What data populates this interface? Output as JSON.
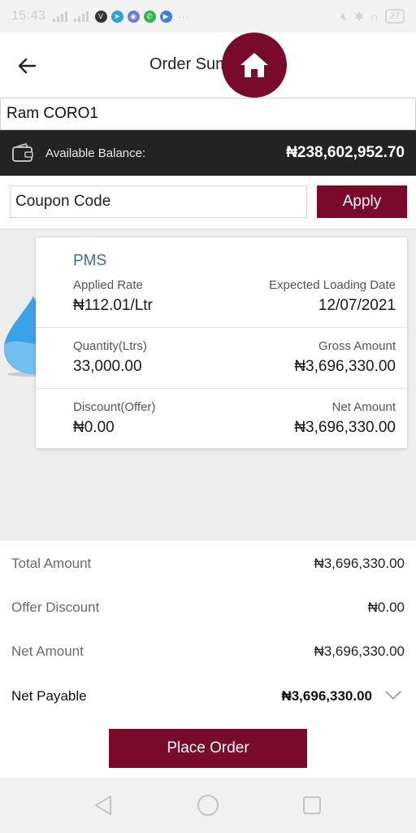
{
  "status_bar": {
    "time": "15:43",
    "battery": "27"
  },
  "header": {
    "title": "Order Summary"
  },
  "customer": {
    "name": "Ram CORO1"
  },
  "balance": {
    "label": "Available Balance:",
    "value": "₦238,602,952.70"
  },
  "coupon": {
    "placeholder": "Coupon Code",
    "apply_label": "Apply"
  },
  "order_card": {
    "product": "PMS",
    "applied_rate_label": "Applied Rate",
    "applied_rate": "₦112.01/Ltr",
    "loading_date_label": "Expected Loading Date",
    "loading_date": "12/07/2021",
    "quantity_label": "Quantity(Ltrs)",
    "quantity": "33,000.00",
    "gross_label": "Gross Amount",
    "gross": "₦3,696,330.00",
    "discount_label": "Discount(Offer)",
    "discount": "₦0.00",
    "net_label": "Net Amount",
    "net": "₦3,696,330.00"
  },
  "summary": {
    "total_label": "Total Amount",
    "total": "₦3,696,330.00",
    "offer_label": "Offer Discount",
    "offer": "₦0.00",
    "net_label": "Net Amount",
    "net": "₦3,696,330.00",
    "payable_label": "Net Payable",
    "payable": "₦3,696,330.00"
  },
  "actions": {
    "place_order": "Place Order"
  },
  "colors": {
    "brand": "#7a0a2c",
    "product_text": "#3e6d86",
    "balance_bg": "#232323"
  }
}
